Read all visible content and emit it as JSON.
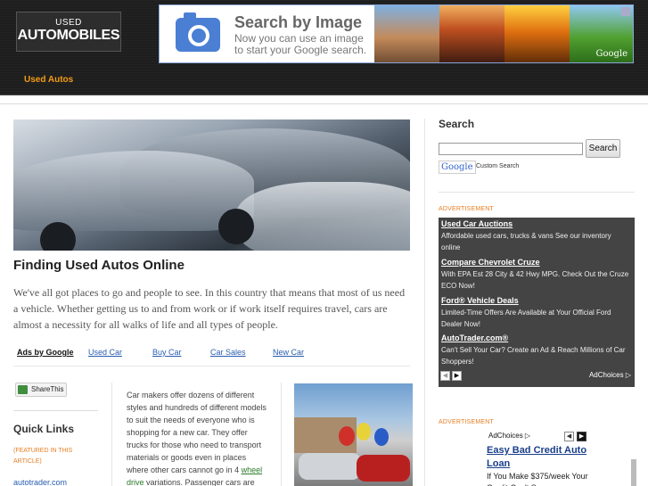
{
  "header": {
    "logo_small": "USED",
    "logo_big": "AUTOMOBILES",
    "nav_item": "Used Autos"
  },
  "banner": {
    "title": "Search by Image",
    "subtitle": "Now you can use an image to start your Google search.",
    "brand": "Google"
  },
  "article": {
    "title": "Finding Used Autos Online",
    "intro": "We've all got places to go and people to see. In this country that means that most of us need a vehicle. Whether getting us to and from work or if work itself requires travel, cars are almost a necessity for all walks of life and all types of people.",
    "body_before_link": "Car makers offer dozens of different styles and hundreds of different models to suit the needs of everyone who is shopping for a new car. They offer trucks for those who need to transport materials or goods even in places where other cars cannot go in 4 ",
    "body_link": "wheel drive",
    "body_after_link": " variations. Passenger cars are"
  },
  "ad_links": {
    "label": "Ads by Google",
    "links": [
      "Used Car",
      "Buy Car",
      "Car Sales",
      "New Car"
    ]
  },
  "share": {
    "label": "ShareThis"
  },
  "quick_links": {
    "title": "Quick Links",
    "featured": "(FEATURED IN THIS ARTICLE)",
    "first_link": "autotrader.com"
  },
  "sidebar": {
    "search_title": "Search",
    "search_button": "Search",
    "google_logo": "Google",
    "custom_search": "Custom Search",
    "advertisement_label": "ADVERTISEMENT",
    "ads": [
      {
        "title": "Used Car Auctions",
        "desc": "Affordable used cars, trucks & vans See our inventory online"
      },
      {
        "title": "Compare Chevrolet Cruze",
        "desc": "With EPA Est 28 City & 42 Hwy MPG. Check Out the Cruze ECO Now!"
      },
      {
        "title": "Ford® Vehicle Deals",
        "desc": "Limited-Time Offers Are Available at Your Official Ford Dealer Now!"
      },
      {
        "title": "AutoTrader.com®",
        "desc": "Can't Sell Your Car? Create an Ad & Reach Millions of Car Shoppers!"
      }
    ],
    "adchoices": "AdChoices ▷",
    "ad2": {
      "adchoices": "AdChoices ▷",
      "title": "Easy Bad Credit Auto Loan",
      "desc": "If You Make $375/week Your Credit Can't S..."
    }
  },
  "colors": {
    "accent": "#f39c12",
    "header_bg": "#1e1e1e",
    "link": "#2a5db0",
    "ad_box": "#444444"
  }
}
